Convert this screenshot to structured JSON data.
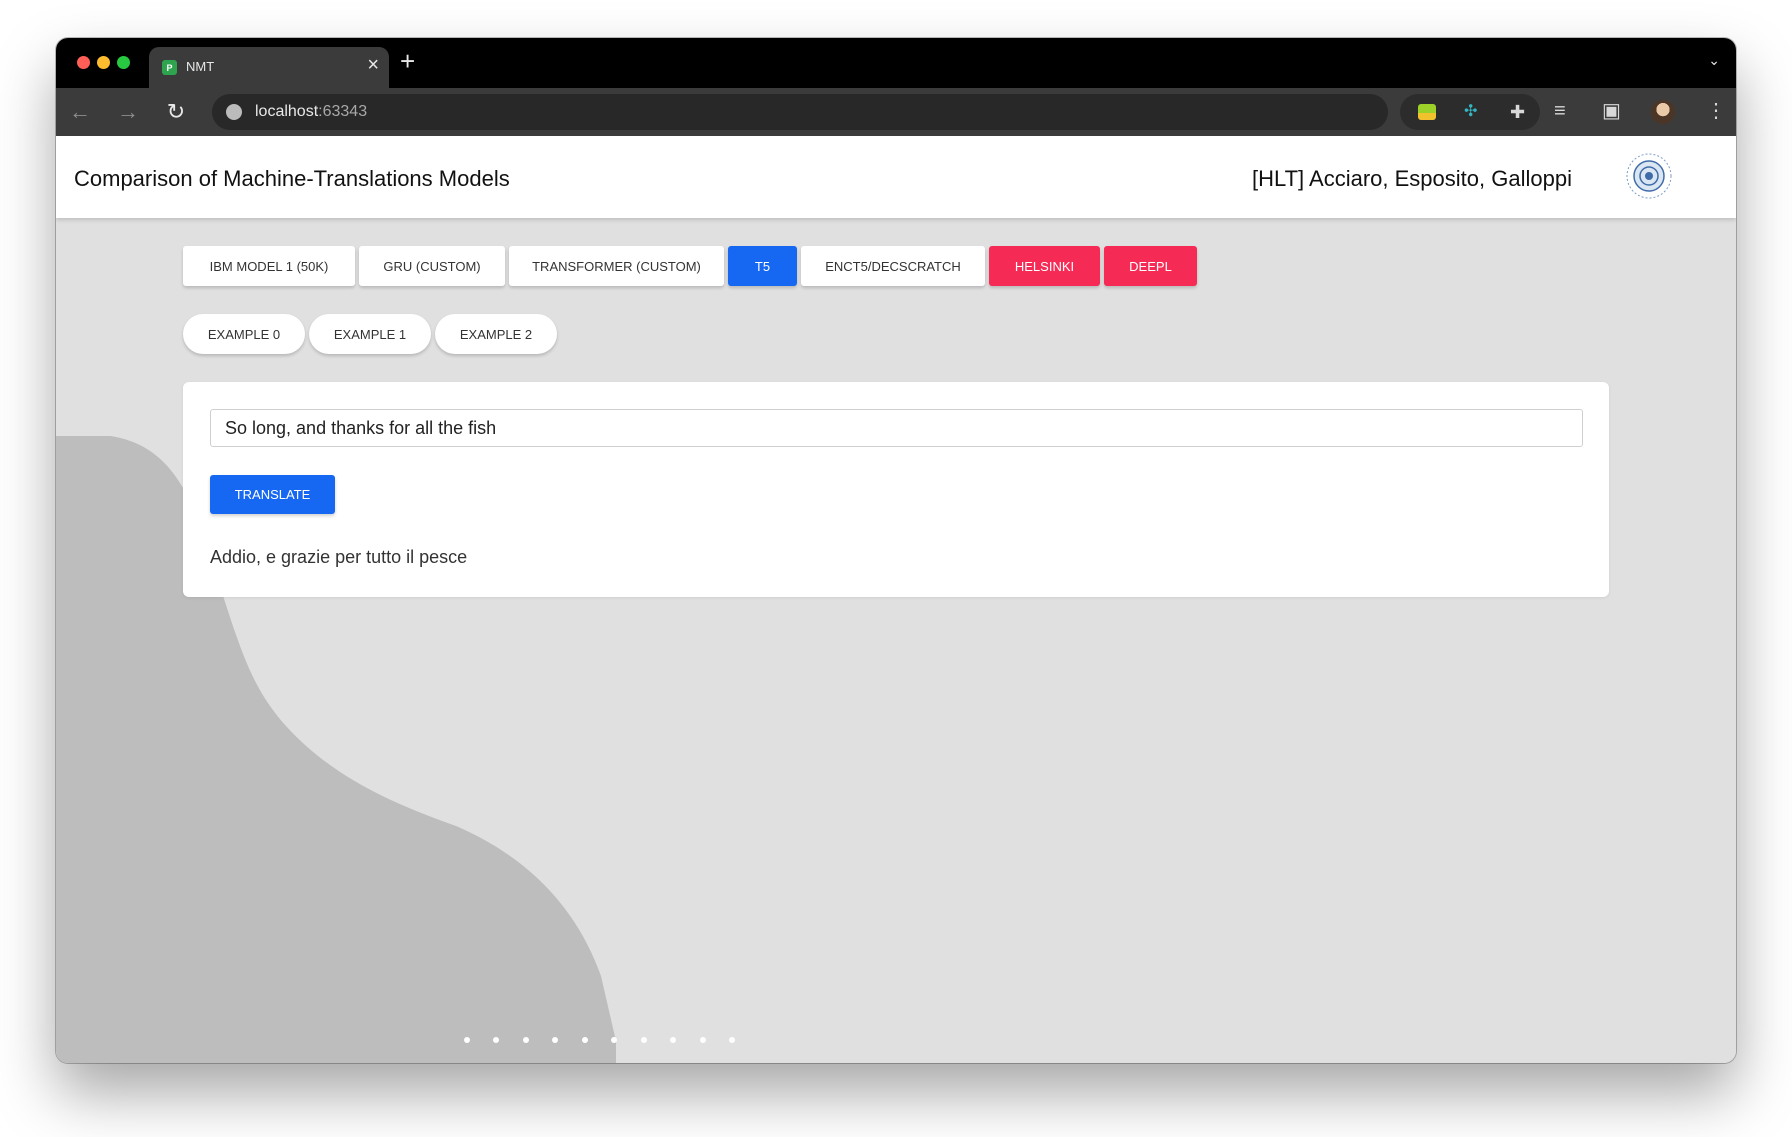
{
  "browser": {
    "tab_title": "NMT",
    "tab_favicon": "pycharm-favicon-icon",
    "url_host": "localhost",
    "url_port": ":63343"
  },
  "header": {
    "title": "Comparison of Machine-Translations Models",
    "authors": "[HLT] Acciaro, Esposito, Galloppi"
  },
  "models": [
    {
      "label": "IBM MODEL 1 (50K)",
      "style": "default"
    },
    {
      "label": "GRU (CUSTOM)",
      "style": "default"
    },
    {
      "label": "TRANSFORMER (CUSTOM)",
      "style": "default"
    },
    {
      "label": "T5",
      "style": "selected"
    },
    {
      "label": "ENCT5/DECSCRATCH",
      "style": "default"
    },
    {
      "label": "HELSINKI",
      "style": "external"
    },
    {
      "label": "DEEPL",
      "style": "external"
    }
  ],
  "examples": [
    {
      "label": "EXAMPLE 0"
    },
    {
      "label": "EXAMPLE 1"
    },
    {
      "label": "EXAMPLE 2"
    }
  ],
  "translator": {
    "input_value": "So long, and thanks for all the fish",
    "translate_label": "TRANSLATE",
    "output_text": "Addio, e grazie per tutto il pesce"
  },
  "colors": {
    "selected": "#1668f2",
    "external": "#f52a55",
    "page_background": "#e0e0e0"
  }
}
